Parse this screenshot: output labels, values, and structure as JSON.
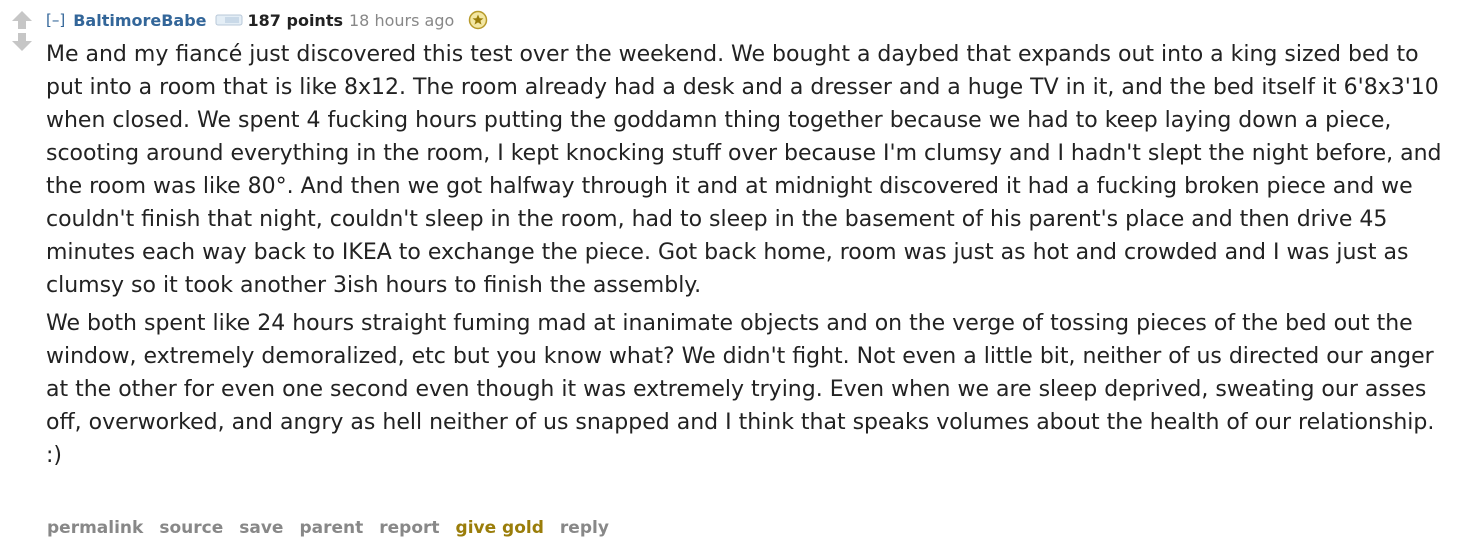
{
  "comment": {
    "collapse_label": "[–]",
    "author": "BaltimoreBabe",
    "score": "187 points",
    "time": "18 hours ago",
    "icons": {
      "upvote": "upvote-arrow-icon",
      "downvote": "downvote-arrow-icon",
      "flair": "flair-badge-icon",
      "gilded": "gilded-star-icon"
    },
    "colors": {
      "author": "#336699",
      "meta": "#888888",
      "gold": "#9a7d0a",
      "body_text": "#222222"
    },
    "paragraphs": [
      "Me and my fiancé just discovered this test over the weekend. We bought a daybed that expands out into a king sized bed to put into a room that is like 8x12. The room already had a desk and a dresser and a huge TV in it, and the bed itself it 6'8x3'10 when closed. We spent 4 fucking hours putting the goddamn thing together because we had to keep laying down a piece, scooting around everything in the room, I kept knocking stuff over because I'm clumsy and I hadn't slept the night before, and the room was like 80°. And then we got halfway through it and at midnight discovered it had a fucking broken piece and we couldn't finish that night, couldn't sleep in the room, had to sleep in the basement of his parent's place and then drive 45 minutes each way back to IKEA to exchange the piece. Got back home, room was just as hot and crowded and I was just as clumsy so it took another 3ish hours to finish the assembly.",
      "We both spent like 24 hours straight fuming mad at inanimate objects and on the verge of tossing pieces of the bed out the window, extremely demoralized, etc but you know what? We didn't fight. Not even a little bit, neither of us directed our anger at the other for even one second even though it was extremely trying. Even when we are sleep deprived, sweating our asses off, overworked, and angry as hell neither of us snapped and I think that speaks volumes about the health of our relationship. :)"
    ],
    "buttons": {
      "permalink": "permalink",
      "source": "source",
      "save": "save",
      "parent": "parent",
      "report": "report",
      "give_gold": "give gold",
      "reply": "reply"
    }
  }
}
